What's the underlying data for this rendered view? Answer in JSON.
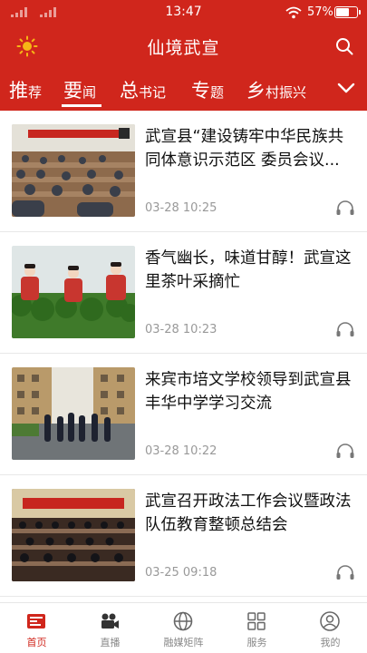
{
  "colors": {
    "brand_red": "#d0261c",
    "text_gray": "#999999"
  },
  "status_bar": {
    "time": "13:47",
    "battery": "57%",
    "wifi_icon": "wifi-icon"
  },
  "header": {
    "title": "仙境武宣",
    "left_icon": "sun-icon",
    "right_icon": "search-icon"
  },
  "tabs": [
    {
      "big": "推",
      "small": "荐"
    },
    {
      "big": "要",
      "small": "闻",
      "active": true
    },
    {
      "big": "总",
      "small": "书记"
    },
    {
      "big": "专",
      "small": "题"
    },
    {
      "big": "乡",
      "small": "村振兴"
    }
  ],
  "tabs_more_icon": "chevron-down-icon",
  "news": [
    {
      "title": "武宣县“建设铸牢中华民族共同体意识示范区 委员会议...",
      "date": "03-28 10:25"
    },
    {
      "title": "香气幽长，味道甘醇！武宣这里茶叶采摘忙",
      "date": "03-28 10:23"
    },
    {
      "title": "来宾市培文学校领导到武宣县丰华中学学习交流",
      "date": "03-28 10:22"
    },
    {
      "title": "武宣召开政法工作会议暨政法队伍教育整顿总结会",
      "date": "03-25 09:18"
    }
  ],
  "bottom_nav": [
    {
      "label": "首页",
      "icon": "home-icon",
      "active": true
    },
    {
      "label": "直播",
      "icon": "video-camera-icon"
    },
    {
      "label": "融媒矩阵",
      "icon": "globe-icon"
    },
    {
      "label": "服务",
      "icon": "grid-icon"
    },
    {
      "label": "我的",
      "icon": "user-icon"
    }
  ]
}
